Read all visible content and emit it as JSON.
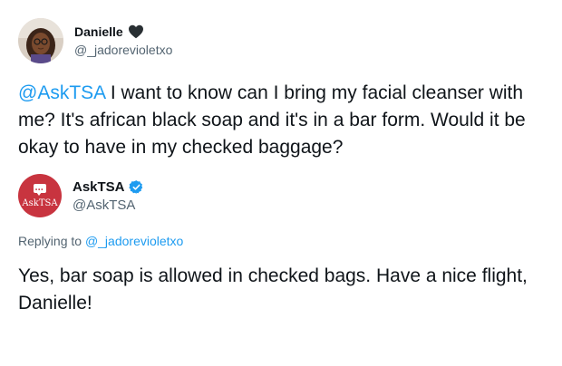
{
  "tweet": {
    "author": {
      "display_name": "Danielle",
      "name_emoji": "black-heart-icon",
      "handle": "@_jadorevioletxo",
      "avatar": "profile-photo"
    },
    "text": {
      "mention": "@AskTSA",
      "body": " I want to know can I bring my facial cleanser with me? It's african black soap and it's in a bar form. Would it be okay to have in my checked baggage?"
    }
  },
  "reply": {
    "author": {
      "display_name": "AskTSA",
      "verified_badge": "verified-badge-icon",
      "handle": "@AskTSA",
      "avatar_label": "AskTSA",
      "avatar_color": "#c8343f"
    },
    "replying_to": {
      "prefix": "Replying to ",
      "handle": "@_jadorevioletxo"
    },
    "text": "Yes, bar soap is allowed in checked bags. Have a nice flight, Danielle!"
  },
  "colors": {
    "link": "#1d9bf0",
    "secondary_text": "#536471",
    "primary_text": "#0f1419"
  }
}
